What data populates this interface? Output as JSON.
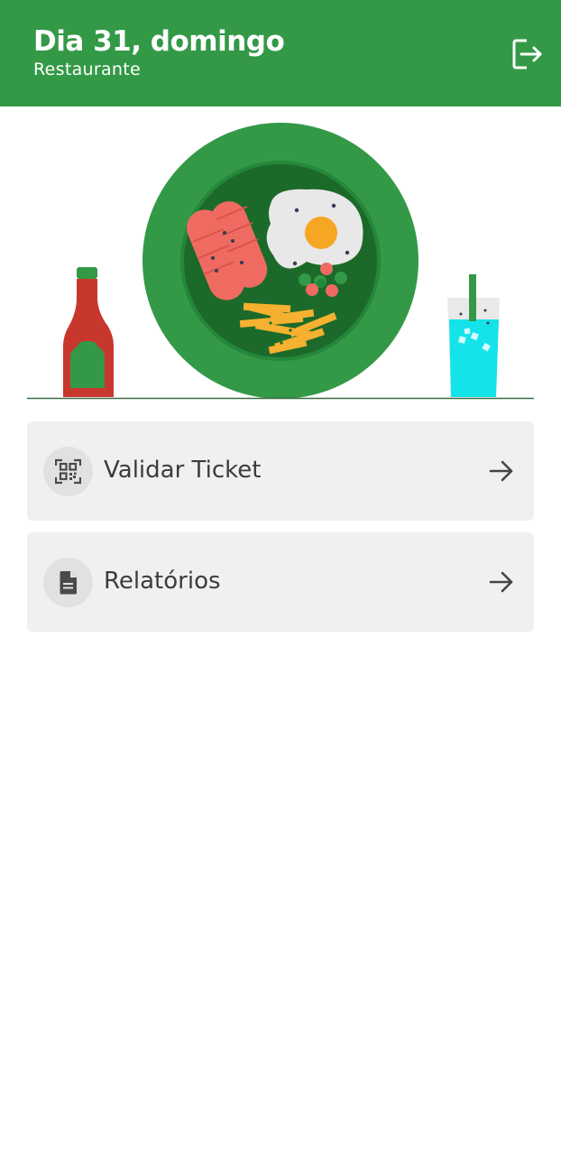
{
  "app_bar": {
    "title": "Dia 31, domingo",
    "subtitle": "Restaurante",
    "logout_icon": "logout-icon",
    "color": "#339947"
  },
  "illustration": {
    "description_icon": "meal-plate-illustration"
  },
  "menu": {
    "items": [
      {
        "label": "Validar Ticket",
        "icon": "qr-code-scanner-icon",
        "trailing_icon": "arrow-forward-icon"
      },
      {
        "label": "Relatórios",
        "icon": "document-icon",
        "trailing_icon": "arrow-forward-icon"
      }
    ]
  }
}
